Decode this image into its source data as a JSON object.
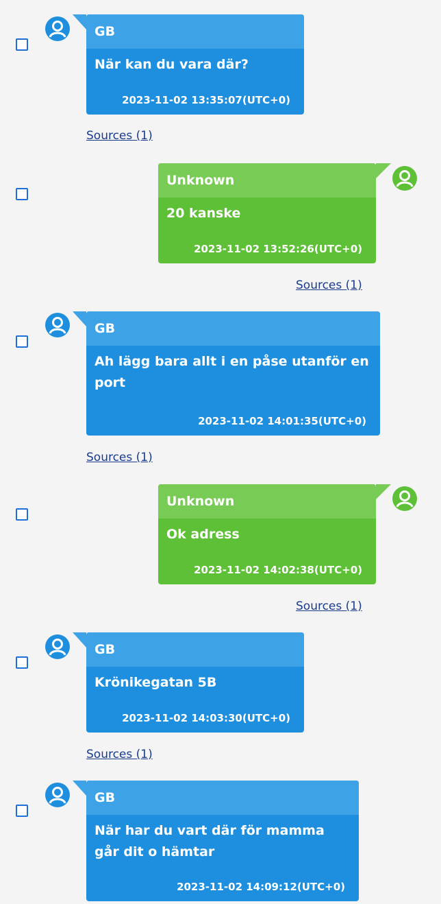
{
  "messages": [
    {
      "sender": "GB",
      "text": "När kan du vara där?",
      "timestamp": "2023-11-02 13:35:07(UTC+0)",
      "sources": "Sources (1)",
      "side": "left"
    },
    {
      "sender": "Unknown",
      "text": "20 kanske",
      "timestamp": "2023-11-02 13:52:26(UTC+0)",
      "sources": "Sources (1)",
      "side": "right"
    },
    {
      "sender": "GB",
      "text": "Ah lägg bara allt i en påse utanför en port",
      "timestamp": "2023-11-02 14:01:35(UTC+0)",
      "sources": "Sources (1)",
      "side": "left"
    },
    {
      "sender": "Unknown",
      "text": "Ok adress",
      "timestamp": "2023-11-02 14:02:38(UTC+0)",
      "sources": "Sources (1)",
      "side": "right"
    },
    {
      "sender": "GB",
      "text": "Krönikegatan 5B",
      "timestamp": "2023-11-02 14:03:30(UTC+0)",
      "sources": "Sources (1)",
      "side": "left"
    },
    {
      "sender": "GB",
      "text": "När har du vart där för mamma går dit o hämtar",
      "timestamp": "2023-11-02 14:09:12(UTC+0)",
      "sources": "",
      "side": "left"
    }
  ],
  "icons": {
    "avatar": "user-avatar-icon",
    "checkbox": "checkbox-icon"
  },
  "colors": {
    "blue_bubble": "#1e8fdf",
    "blue_header": "#3ea2e6",
    "green_bubble": "#5ec036",
    "green_header": "#78cc55",
    "avatar_blue": "#1e8fdf",
    "avatar_green": "#5ec036"
  }
}
